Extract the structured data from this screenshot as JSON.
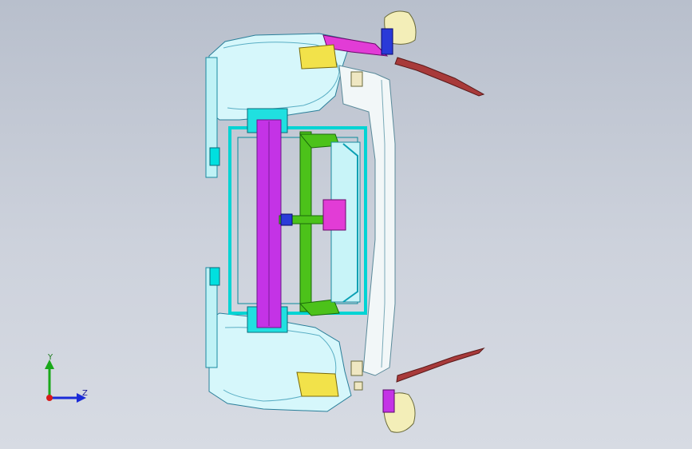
{
  "viewport": {
    "bg_top": "#b8bfcc",
    "bg_bottom": "#d7dbe3"
  },
  "colors": {
    "frame_cyan": "#00e0e0",
    "body_light": "#d6f7fb",
    "purple_beam": "#c433e6",
    "green_bracket": "#4cc21a",
    "magenta": "#e23cd6",
    "yellow_lamp": "#f2e24a",
    "mirror": "#f3eeb8",
    "wiper_red": "#a83a3a",
    "blue_part": "#2a3ad8"
  },
  "triad": {
    "y_label": "Y",
    "z_label": "Z",
    "icon": "coordinate-triad-icon"
  }
}
